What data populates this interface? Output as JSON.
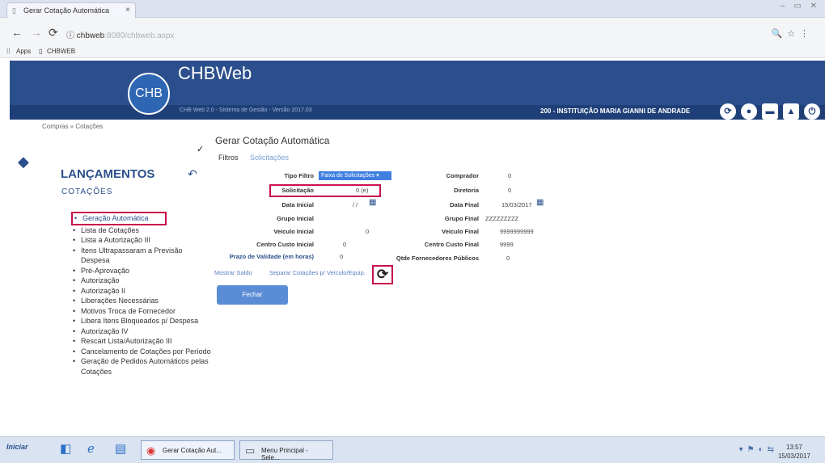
{
  "browser": {
    "tab_title": "Gerar Cotação Automática",
    "tab_close": "×",
    "url_prefix": "ⓘ chbweb",
    "url_rest": ":8080/chbweb.aspx",
    "bookmarks": [
      "Apps",
      "CHBWEB"
    ]
  },
  "header": {
    "logo": "CHB",
    "app_title": "CHBWeb",
    "strip_text": "CHB Web 2.0 - Sistema de Gestão - Versão 2017.03",
    "institution": "200 - INSTITUIÇÃO MARIA GIANNI DE ANDRADE"
  },
  "breadcrumb": "Compras » Cotações",
  "sidebar": {
    "title": "LANÇAMENTOS",
    "subtitle": "COTAÇÕES",
    "items": [
      "Geração Automática",
      "Lista de Cotações",
      "Lista a Autorização III",
      "Itens Ultrapassaram a Previsão Despesa",
      "Pré-Aprovação",
      "Autorização",
      "Autorização II",
      "Liberações Necessárias",
      "Motivos Troca de Fornecedor",
      "Libera Itens Bloqueados p/ Despesa",
      "Autorização IV",
      "Rescart Lista/Autorização III",
      "Cancelamento de Cotações por Período",
      "Geração de Pedidos Automáticos pelas Cotações"
    ]
  },
  "main": {
    "title": "Gerar Cotação Automática",
    "tabs": [
      "Filtros",
      "Solicitações"
    ],
    "form": {
      "tipo_filtro_label": "Tipo Filtro",
      "tipo_filtro_value": "Faixa de Solicitações",
      "comprador_label": "Comprador",
      "comprador_value": "0",
      "solicitacao_label": "Solicitação",
      "solicitacao_value": "0 (e)",
      "diretoria_label": "Diretoria",
      "diretoria_value": "0",
      "data_inicial_label": "Data Inicial",
      "data_inicial_value": "/ /",
      "data_final_label": "Data Final",
      "data_final_value": "15/03/2017",
      "grupo_inicial_label": "Grupo Inicial",
      "grupo_final_label": "Grupo Final",
      "grupo_final_value": "ZZZZZZZZZ",
      "veiculo_inicial_label": "Veículo Inicial",
      "veiculo_inicial_value": "0",
      "veiculo_final_label": "Veículo Final",
      "veiculo_final_value": "9999999999",
      "cc_inicial_label": "Centro Custo Inicial",
      "cc_inicial_value": "0",
      "cc_final_label": "Centro Custo Final",
      "cc_final_value": "9999",
      "prazo_label": "Prazo de Validade (em horas)",
      "prazo_value": "0",
      "qtde_label": "Qtde Fornecedores Públicos",
      "qtde_value": "0",
      "mostrar_saldo": "Mostrar Saldo",
      "separar": "Separar Cotações p/ Veículo/Equip.",
      "refresh_icon": "⟳",
      "fechar": "Fechar"
    }
  },
  "taskbar": {
    "start": "Iniciar",
    "windows": [
      "Gerar Cotação Aut...",
      "Menu Principal - Sele..."
    ],
    "time": "13:57",
    "date": "15/03/2017"
  }
}
